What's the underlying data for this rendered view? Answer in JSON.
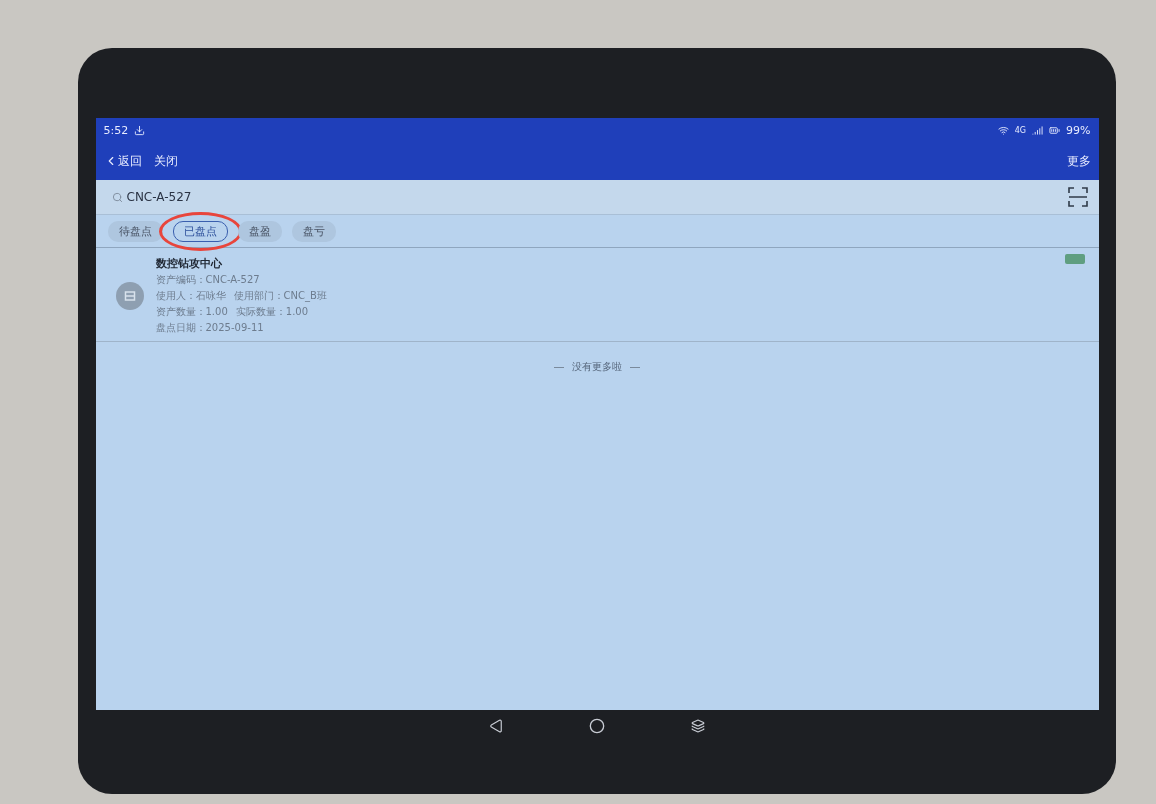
{
  "status_bar": {
    "time": "5:52",
    "network": "4G",
    "battery": "99%"
  },
  "app_bar": {
    "back": "返回",
    "close": "关闭",
    "more": "更多"
  },
  "search": {
    "value": "CNC-A-527"
  },
  "tabs": [
    {
      "label": "待盘点",
      "selected": false,
      "circled": false
    },
    {
      "label": "已盘点",
      "selected": true,
      "circled": true
    },
    {
      "label": "盘盈",
      "selected": false,
      "circled": false
    },
    {
      "label": "盘亏",
      "selected": false,
      "circled": false
    }
  ],
  "items": [
    {
      "title": "数控钻攻中心",
      "color": "#5f9e80",
      "lines": [
        [
          {
            "label": "资产编码：",
            "value": "CNC-A-527"
          }
        ],
        [
          {
            "label": "使用人：",
            "value": "石咏华"
          },
          {
            "label": "使用部门：",
            "value": "CNC_B班"
          }
        ],
        [
          {
            "label": "资产数量：",
            "value": "1.00"
          },
          {
            "label": "实际数量：",
            "value": "1.00"
          }
        ],
        [
          {
            "label": "盘点日期：",
            "value": "2025-09-11"
          }
        ]
      ]
    }
  ],
  "end_note": "没有更多啦"
}
